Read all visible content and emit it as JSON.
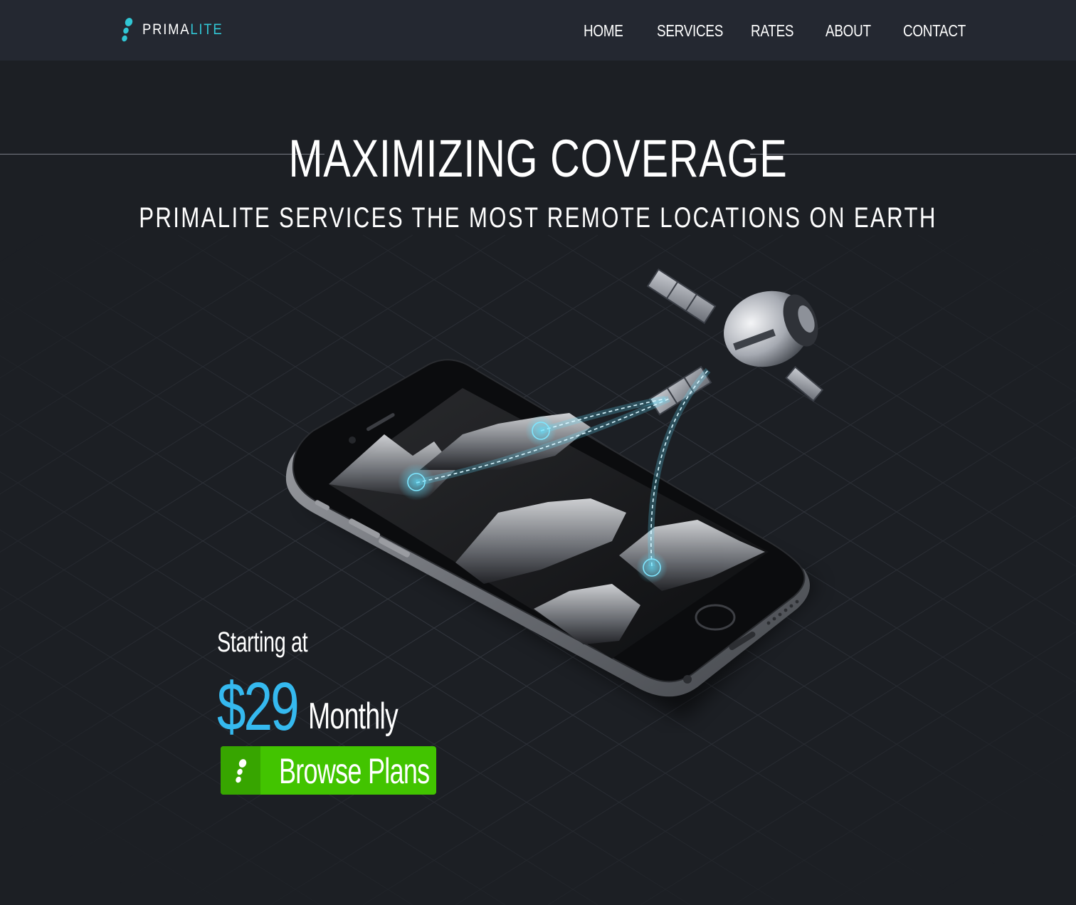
{
  "brand": {
    "name_part1": "PRIMA",
    "name_part2": "LITE",
    "accent_color": "#31c6d4"
  },
  "nav": {
    "items": [
      {
        "label": "HOME"
      },
      {
        "label": "SERVICES"
      },
      {
        "label": "RATES"
      },
      {
        "label": "ABOUT"
      },
      {
        "label": "CONTACT"
      }
    ]
  },
  "hero": {
    "title": "MAXIMIZING COVERAGE",
    "subtitle": "PRIMALITE SERVICES THE MOST REMOTE LOCATIONS ON EARTH"
  },
  "pricing": {
    "intro": "Starting at",
    "price": "$29",
    "period": "Monthly",
    "price_color": "#35b9ef"
  },
  "cta": {
    "label": "Browse Plans",
    "color": "#42c400"
  },
  "icons": [
    "logo-droplets-icon",
    "satellite-icon",
    "phone-illustration",
    "connection-node-icon"
  ]
}
